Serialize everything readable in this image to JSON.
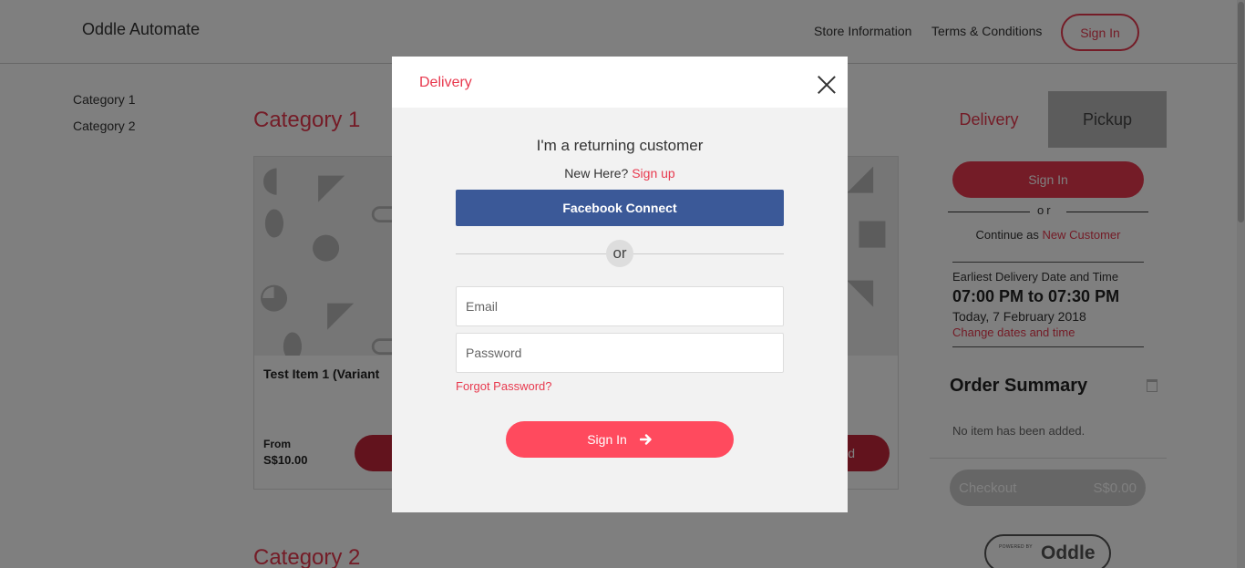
{
  "header": {
    "brand": "Oddle Automate",
    "nav": {
      "store_info": "Store Information",
      "terms": "Terms & Conditions",
      "sign_in": "Sign In"
    }
  },
  "sidebar": {
    "items": [
      {
        "label": "Category 1"
      },
      {
        "label": "Category 2"
      }
    ]
  },
  "main": {
    "categories": [
      {
        "title": "Category 1"
      },
      {
        "title": "Category 2"
      }
    ],
    "item": {
      "name": "Test Item 1 (Variant",
      "price_prefix": "From",
      "price": "S$10.00",
      "add_label_visible": "d"
    }
  },
  "order_panel": {
    "tabs": {
      "delivery": "Delivery",
      "pickup": "Pickup"
    },
    "sign_in": "Sign In",
    "or": "or",
    "continue_prefix": "Continue as",
    "continue_link": "New Customer",
    "earliest_label": "Earliest Delivery Date and Time",
    "earliest_time": "07:00 PM to 07:30 PM",
    "earliest_date": "Today, 7 February 2018",
    "change_link": "Change dates and time",
    "summary_title": "Order Summary",
    "empty_message": "No item has been added.",
    "checkout_label": "Checkout",
    "checkout_total": "S$0.00",
    "powered_by": "POWERED BY",
    "oddle_logo": "Oddle"
  },
  "modal": {
    "title": "Delivery",
    "heading": "I'm a returning customer",
    "new_here": "New Here?",
    "sign_up": "Sign up",
    "facebook": "Facebook Connect",
    "divider": "or",
    "email_placeholder": "Email",
    "password_placeholder": "Password",
    "forgot": "Forgot Password?",
    "sign_in": "Sign In"
  },
  "colors": {
    "accent": "#e8394e",
    "facebook": "#3b5998",
    "modal_button": "#ff4a5e"
  },
  "icons": [
    "close-icon",
    "arrow-right-icon",
    "trash-icon"
  ]
}
